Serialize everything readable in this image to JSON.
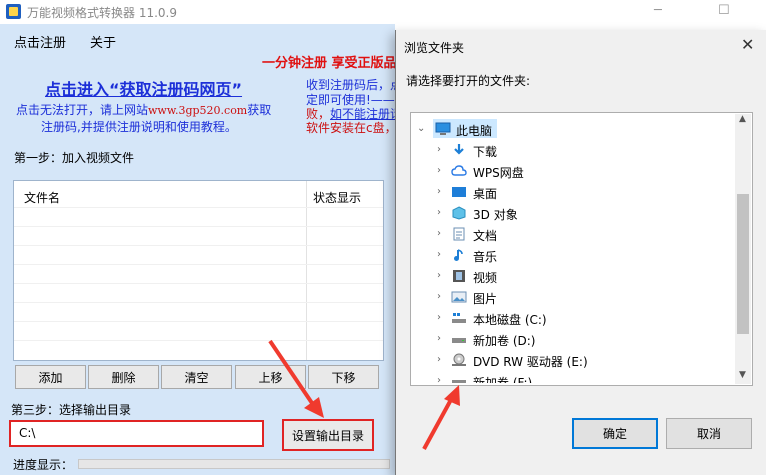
{
  "window": {
    "title": "万能视频格式转换器 11.0.9",
    "controls": [
      "─",
      "☐"
    ]
  },
  "menu": {
    "register": "点击注册",
    "about": "关于"
  },
  "promo": {
    "title": "点击进入“获取注册码网页”",
    "line1_prefix": "点击无法打开，请上网站",
    "line1_url": "www.3gp520.com",
    "line1_suffix": "获取",
    "line2": "注册码,并提供注册说明和使用教程。"
  },
  "registration": {
    "slogan": "一分钟注册  享受正版品",
    "note1": "收到注册码后，点",
    "note2": "定即可使用!——",
    "note3_prefix": "败，",
    "note3_link": "如不能注册请",
    "note4": "软件安装在c盘，"
  },
  "step1": {
    "label": "第一步：加入视频文件"
  },
  "file_table": {
    "columns": [
      "文件名",
      "状态显示"
    ],
    "rows": []
  },
  "table_buttons": [
    "添加",
    "删除",
    "清空",
    "上移",
    "下移"
  ],
  "step3": {
    "label": "第三步：选择输出目录",
    "path_value": "C:\\",
    "set_button": "设置输出目录"
  },
  "progress": {
    "label": "进度显示：",
    "value": 0
  },
  "dialog": {
    "title": "浏览文件夹",
    "close": "✕",
    "prompt": "请选择要打开的文件夹:",
    "tree": {
      "root": "此电脑",
      "children": [
        "下载",
        "WPS网盘",
        "桌面",
        "3D 对象",
        "文档",
        "音乐",
        "视频",
        "图片",
        "本地磁盘 (C:)",
        "新加卷 (D:)",
        "DVD RW 驱动器 (E:)",
        "新加卷 (F:)"
      ]
    },
    "ok": "确定",
    "cancel": "取消"
  },
  "colors": {
    "client_bg": "#d5e6f8",
    "highlight_red": "#e02424",
    "link_blue": "#1c2fd8",
    "dialog_accent": "#0078d7"
  }
}
